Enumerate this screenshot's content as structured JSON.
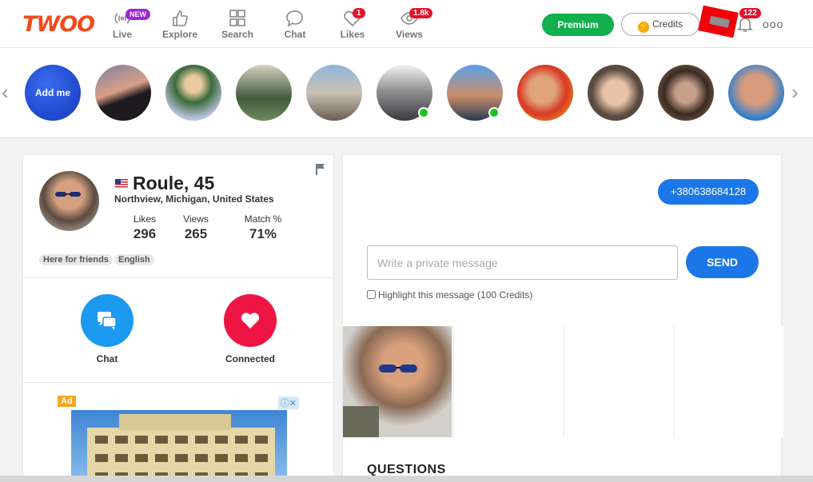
{
  "app": {
    "logo": "TWOO"
  },
  "nav": [
    {
      "label": "Live",
      "badge": "NEW"
    },
    {
      "label": "Explore"
    },
    {
      "label": "Search"
    },
    {
      "label": "Chat"
    },
    {
      "label": "Likes",
      "badge": "1"
    },
    {
      "label": "Views",
      "badge": "1.8k"
    }
  ],
  "header": {
    "premium_label": "Premium",
    "credits_label": "Credits",
    "notifications_count": "122",
    "more_label": "ooo"
  },
  "stories": {
    "add_label": "Add me"
  },
  "profile": {
    "name": "Roule, 45",
    "location": "Northview, Michigan, United States",
    "stats": [
      {
        "label": "Likes",
        "value": "296"
      },
      {
        "label": "Views",
        "value": "265"
      },
      {
        "label": "Match %",
        "value": "71%"
      }
    ],
    "tags": [
      "Here for friends",
      "English"
    ],
    "actions": [
      {
        "label": "Chat"
      },
      {
        "label": "Connected"
      }
    ],
    "ad_label": "Ad",
    "ad_info": "ⓘ✕"
  },
  "conversation": {
    "phone": "+380638684128",
    "message_placeholder": "Write a private message",
    "send_label": "SEND",
    "highlight_label": "Highlight this message (100 Credits)",
    "questions_heading": "QUESTIONS"
  },
  "colors": {
    "brand": "#f24a1d",
    "primary": "#1b76e8",
    "premium": "#11b04d",
    "danger": "#e8102b"
  }
}
